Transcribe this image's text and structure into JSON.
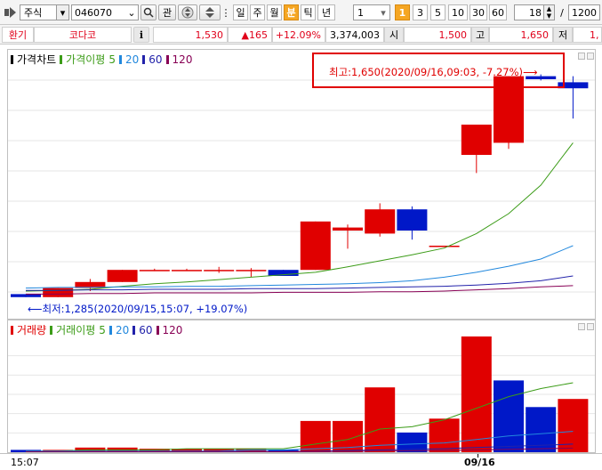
{
  "toolbar": {
    "market_select": "주식",
    "code_input": "046070",
    "search_label": "관",
    "periods": [
      "일",
      "주",
      "월",
      "분",
      "틱",
      "년"
    ],
    "active_period": "분",
    "interval_select": "1",
    "minute_buttons": [
      "1",
      "3",
      "5",
      "10",
      "30",
      "60"
    ],
    "active_minute": "1",
    "count_value": "18",
    "slash": "/",
    "max_count": "1200"
  },
  "quote": {
    "exchange_label": "환기",
    "stock_name": "코다코",
    "info_label": "i",
    "price": "1,530",
    "change": "▲165",
    "change_rate": "+12.09%",
    "volume": "3,374,003",
    "open_label": "시",
    "open_value": "1,500",
    "high_label": "고",
    "high_value": "1,650",
    "low_label": "저",
    "low_value": "1,"
  },
  "price_panel": {
    "legend": {
      "title": "가격차트",
      "ma_title": "가격이평",
      "ma_periods": [
        "5",
        "20",
        "60",
        "120"
      ]
    },
    "high_annotation": "최고:1,650(2020/09/16,09:03, -7.27%)⟶",
    "low_annotation": "⟵최저:1,285(2020/09/15,15:07, +19.07%)"
  },
  "volume_panel": {
    "legend": {
      "title": "거래량",
      "ma_title": "거래이평",
      "ma_periods": [
        "5",
        "20",
        "60",
        "120"
      ]
    }
  },
  "x_axis": {
    "labels": [
      {
        "text": "15:07",
        "bold": false
      },
      {
        "text": "09/16",
        "bold": true
      }
    ]
  },
  "colors": {
    "up": "#e00000",
    "down": "#0018c8",
    "ma5": "#3c9c18",
    "ma20": "#2288dd",
    "ma60": "#2222aa",
    "ma120": "#880055",
    "highlight_box": "#e00000"
  },
  "chart_data": [
    {
      "type": "candlestick",
      "title": "가격차트",
      "ylim": [
        1270,
        1670
      ],
      "candles": [
        {
          "o": 1290,
          "h": 1290,
          "l": 1285,
          "c": 1285
        },
        {
          "o": 1285,
          "h": 1300,
          "l": 1285,
          "c": 1300
        },
        {
          "o": 1300,
          "h": 1315,
          "l": 1295,
          "c": 1310
        },
        {
          "o": 1310,
          "h": 1330,
          "l": 1310,
          "c": 1330
        },
        {
          "o": 1330,
          "h": 1332,
          "l": 1328,
          "c": 1330
        },
        {
          "o": 1330,
          "h": 1332,
          "l": 1328,
          "c": 1330
        },
        {
          "o": 1330,
          "h": 1335,
          "l": 1325,
          "c": 1330
        },
        {
          "o": 1330,
          "h": 1333,
          "l": 1318,
          "c": 1330
        },
        {
          "o": 1330,
          "h": 1330,
          "l": 1320,
          "c": 1320
        },
        {
          "o": 1330,
          "h": 1410,
          "l": 1330,
          "c": 1410
        },
        {
          "o": 1395,
          "h": 1405,
          "l": 1365,
          "c": 1400
        },
        {
          "o": 1390,
          "h": 1440,
          "l": 1385,
          "c": 1430
        },
        {
          "o": 1430,
          "h": 1435,
          "l": 1380,
          "c": 1395
        },
        {
          "o": 1370,
          "h": 1370,
          "l": 1370,
          "c": 1370
        },
        {
          "o": 1520,
          "h": 1540,
          "l": 1490,
          "c": 1570
        },
        {
          "o": 1540,
          "h": 1650,
          "l": 1530,
          "c": 1650
        },
        {
          "o": 1650,
          "h": 1653,
          "l": 1643,
          "c": 1645
        },
        {
          "o": 1640,
          "h": 1650,
          "l": 1580,
          "c": 1630
        }
      ],
      "series": [
        {
          "name": "5",
          "values": [
            1295,
            1296,
            1298,
            1303,
            1307,
            1310,
            1314,
            1318,
            1322,
            1326,
            1335,
            1345,
            1355,
            1366,
            1390,
            1423,
            1470,
            1540
          ]
        },
        {
          "name": "20",
          "values": [
            1300,
            1301,
            1301,
            1302,
            1302,
            1303,
            1303,
            1304,
            1305,
            1306,
            1307,
            1309,
            1312,
            1318,
            1326,
            1336,
            1348,
            1370
          ]
        },
        {
          "name": "60",
          "values": [
            1296,
            1296,
            1297,
            1297,
            1298,
            1298,
            1298,
            1299,
            1299,
            1299,
            1300,
            1301,
            1302,
            1303,
            1305,
            1308,
            1312,
            1320
          ]
        },
        {
          "name": "120",
          "values": [
            1290,
            1290,
            1291,
            1291,
            1292,
            1292,
            1292,
            1292,
            1293,
            1293,
            1293,
            1294,
            1294,
            1295,
            1297,
            1299,
            1302,
            1304
          ]
        }
      ]
    },
    {
      "type": "bar",
      "title": "거래량",
      "ylim": [
        0,
        100
      ],
      "values": [
        2,
        2,
        4,
        4,
        3,
        3,
        3,
        3,
        2,
        27,
        27,
        56,
        17,
        29,
        100,
        62,
        39,
        46
      ],
      "up": [
        false,
        true,
        true,
        true,
        true,
        true,
        true,
        true,
        false,
        true,
        true,
        true,
        false,
        true,
        true,
        false,
        false,
        true
      ],
      "series": [
        {
          "name": "5",
          "values": [
            1,
            1,
            2,
            2,
            2,
            3,
            3,
            3,
            3,
            7,
            11,
            20,
            22,
            28,
            38,
            48,
            55,
            60
          ]
        },
        {
          "name": "20",
          "values": [
            1,
            1,
            1,
            1,
            1,
            1,
            1,
            2,
            2,
            3,
            4,
            6,
            7,
            8,
            11,
            14,
            16,
            18
          ]
        },
        {
          "name": "60",
          "values": [
            0.5,
            0.5,
            0.5,
            0.6,
            0.6,
            0.6,
            0.7,
            0.7,
            0.7,
            1,
            1.5,
            2,
            2.5,
            3,
            4,
            5,
            6,
            7
          ]
        },
        {
          "name": "120",
          "values": [
            0.3,
            0.3,
            0.3,
            0.3,
            0.3,
            0.3,
            0.3,
            0.3,
            0.3,
            0.5,
            0.7,
            1,
            1.2,
            1.5,
            2,
            2.5,
            3,
            3.5
          ]
        }
      ]
    }
  ]
}
